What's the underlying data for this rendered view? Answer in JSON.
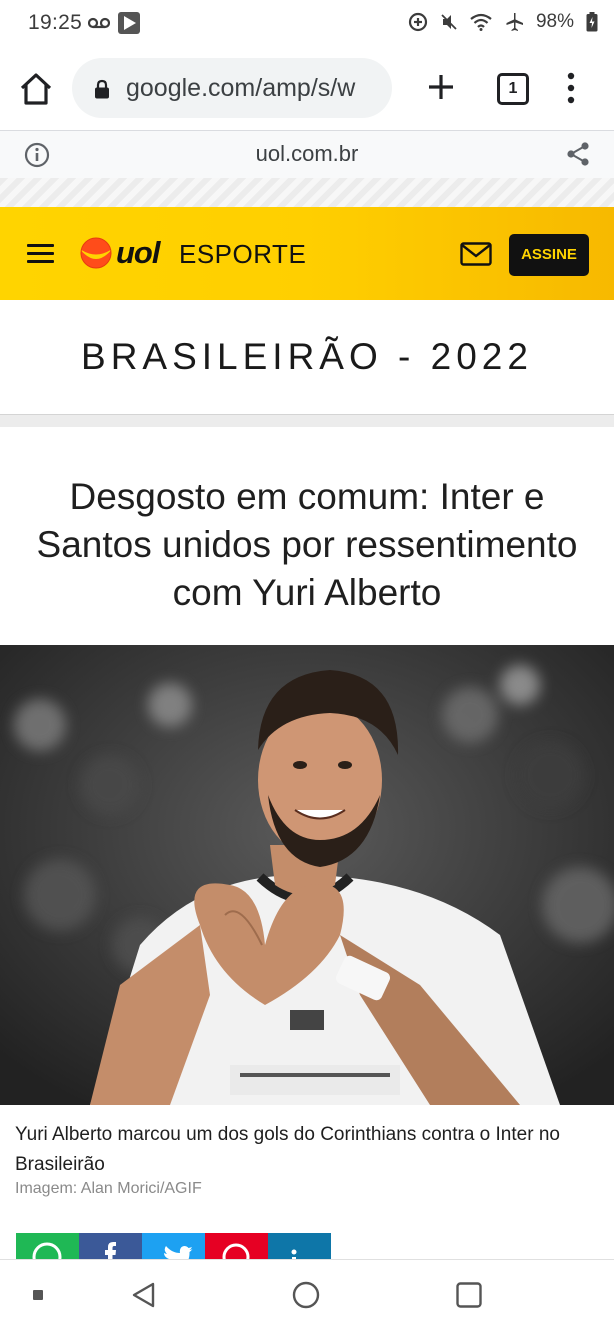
{
  "status_bar": {
    "time": "19:25",
    "battery": "98%"
  },
  "browser": {
    "url": "google.com/amp/s/w",
    "tab_count": "1",
    "amp_domain": "uol.com.br"
  },
  "site": {
    "logo_text": "uol",
    "section": "ESPORTE",
    "subscribe_label": "ASSINE",
    "brand_color": "#ffd400"
  },
  "article": {
    "category": "BRASILEIRÃO - 2022",
    "headline": "Desgosto em comum: Inter e Santos unidos por ressentimento com Yuri Alberto",
    "image_caption": "Yuri Alberto marcou um dos gols do Corinthians contra o Inter no Brasileirão",
    "image_credit": "Imagem: Alan Morici/AGIF"
  },
  "share": [
    {
      "name": "whatsapp",
      "color": "#1fb855"
    },
    {
      "name": "facebook",
      "color": "#3b5998"
    },
    {
      "name": "twitter",
      "color": "#1da1f2"
    },
    {
      "name": "pinterest",
      "color": "#e60023"
    },
    {
      "name": "linkedin",
      "color": "#0e76a8"
    }
  ]
}
